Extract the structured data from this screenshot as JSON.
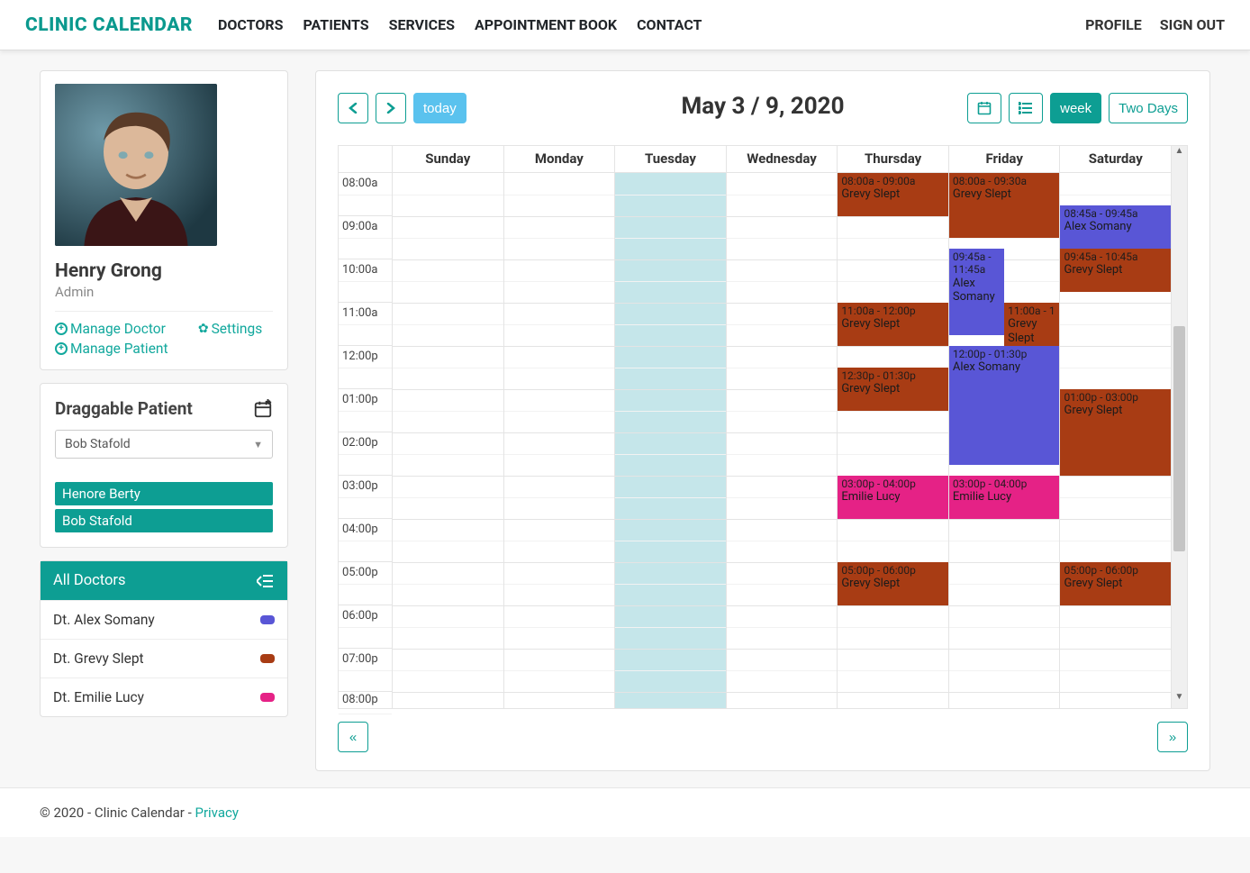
{
  "brand": "CLINIC CALENDAR",
  "nav": [
    "DOCTORS",
    "PATIENTS",
    "SERVICES",
    "APPOINTMENT BOOK",
    "CONTACT"
  ],
  "navRight": [
    "PROFILE",
    "SIGN OUT"
  ],
  "profile": {
    "name": "Henry Grong",
    "role": "Admin",
    "links": {
      "manageDoctor": "Manage Doctor",
      "settings": "Settings",
      "managePatient": "Manage Patient"
    }
  },
  "draggable": {
    "title": "Draggable Patient",
    "selected": "Bob Stafold",
    "chips": [
      "Henore Berty",
      "Bob Stafold"
    ]
  },
  "doctors": {
    "all": "All Doctors",
    "items": [
      {
        "name": "Dt. Alex Somany",
        "color": "#5956d6"
      },
      {
        "name": "Dt. Grevy Slept",
        "color": "#a83c14"
      },
      {
        "name": "Dt. Emilie Lucy",
        "color": "#e52286"
      }
    ]
  },
  "toolbar": {
    "today": "today",
    "week": "week",
    "twoDays": "Two Days"
  },
  "dateTitle": "May 3 / 9, 2020",
  "dayNames": [
    "Sunday",
    "Monday",
    "Tuesday",
    "Wednesday",
    "Thursday",
    "Friday",
    "Saturday"
  ],
  "hours": [
    "08:00a",
    "09:00a",
    "10:00a",
    "11:00a",
    "12:00p",
    "01:00p",
    "02:00p",
    "03:00p",
    "04:00p",
    "05:00p",
    "06:00p",
    "07:00p",
    "08:00p"
  ],
  "todayIndex": 2,
  "events": [
    {
      "day": 4,
      "startMin": 0,
      "endMin": 60,
      "time": "08:00a - 09:00a",
      "name": "Grevy Slept",
      "color": "#a83c14"
    },
    {
      "day": 4,
      "startMin": 180,
      "endMin": 240,
      "time": "11:00a - 12:00p",
      "name": "Grevy Slept",
      "color": "#a83c14"
    },
    {
      "day": 4,
      "startMin": 270,
      "endMin": 330,
      "time": "12:30p - 01:30p",
      "name": "Grevy Slept",
      "color": "#a83c14"
    },
    {
      "day": 4,
      "startMin": 420,
      "endMin": 480,
      "time": "03:00p - 04:00p",
      "name": "Emilie Lucy",
      "color": "#e52286"
    },
    {
      "day": 4,
      "startMin": 540,
      "endMin": 600,
      "time": "05:00p - 06:00p",
      "name": "Grevy Slept",
      "color": "#a83c14"
    },
    {
      "day": 5,
      "startMin": 0,
      "endMin": 90,
      "time": "08:00a - 09:30a",
      "name": "Grevy Slept",
      "color": "#a83c14"
    },
    {
      "day": 5,
      "startMin": 105,
      "endMin": 225,
      "time": "09:45a - 11:45a",
      "name": "Alex Somany",
      "color": "#5956d6",
      "widthPct": 50,
      "leftPct": 0
    },
    {
      "day": 5,
      "startMin": 180,
      "endMin": 240,
      "time": "11:00a - 1",
      "name": "Grevy Slept",
      "color": "#a83c14",
      "widthPct": 50,
      "leftPct": 50
    },
    {
      "day": 5,
      "startMin": 240,
      "endMin": 405,
      "time": "12:00p - 01:30p",
      "name": "Alex Somany",
      "color": "#5956d6"
    },
    {
      "day": 5,
      "startMin": 420,
      "endMin": 480,
      "time": "03:00p - 04:00p",
      "name": "Emilie Lucy",
      "color": "#e52286"
    },
    {
      "day": 6,
      "startMin": 45,
      "endMin": 105,
      "time": "08:45a - 09:45a",
      "name": "Alex Somany",
      "color": "#5956d6"
    },
    {
      "day": 6,
      "startMin": 105,
      "endMin": 165,
      "time": "09:45a - 10:45a",
      "name": "Grevy Slept",
      "color": "#a83c14"
    },
    {
      "day": 6,
      "startMin": 300,
      "endMin": 420,
      "time": "01:00p - 03:00p",
      "name": "Grevy Slept",
      "color": "#a83c14"
    },
    {
      "day": 6,
      "startMin": 540,
      "endMin": 600,
      "time": "05:00p - 06:00p",
      "name": "Grevy Slept",
      "color": "#a83c14"
    }
  ],
  "footer": {
    "text": "© 2020 - Clinic Calendar - ",
    "privacy": "Privacy"
  }
}
